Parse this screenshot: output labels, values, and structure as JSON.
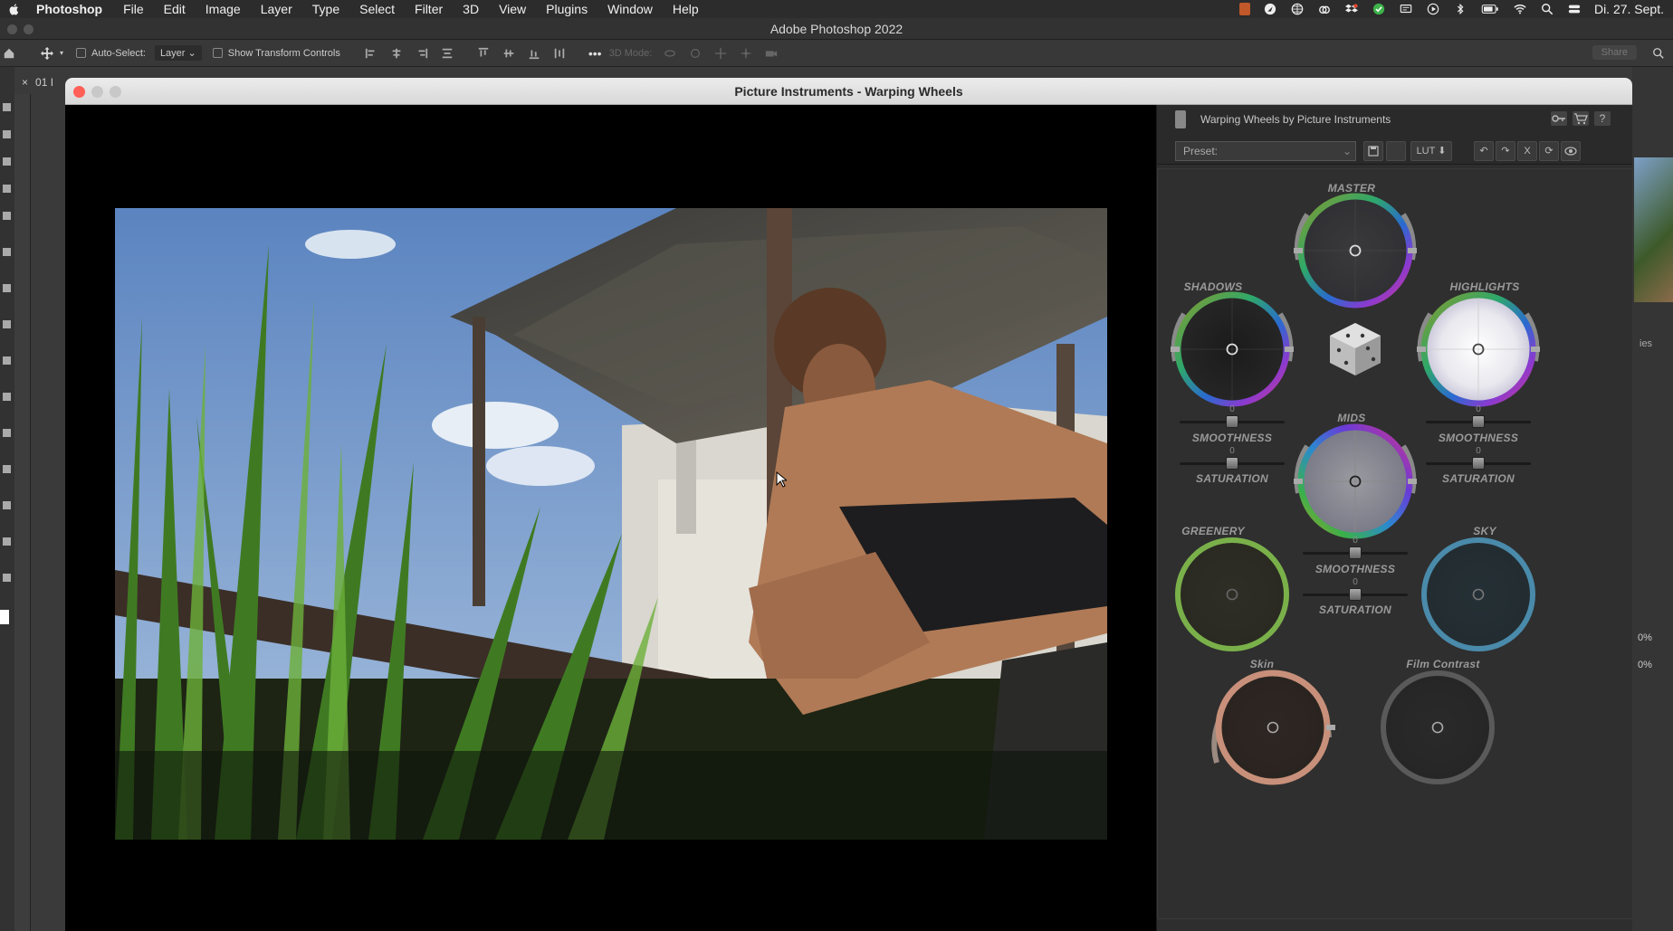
{
  "menubar": {
    "app_name": "Photoshop",
    "items": [
      "File",
      "Edit",
      "Image",
      "Layer",
      "Type",
      "Select",
      "Filter",
      "3D",
      "View",
      "Plugins",
      "Window",
      "Help"
    ],
    "clock": "Di. 27. Sept."
  },
  "ps": {
    "window_title": "Adobe Photoshop 2022",
    "options": {
      "auto_select_label": "Auto-Select:",
      "auto_select_value": "Layer",
      "show_transform_label": "Show Transform Controls",
      "mode_3d_label": "3D Mode:",
      "share_label": "Share"
    },
    "doc_tab": "01 I",
    "right_panel_text": "ies",
    "right_values": [
      "0%",
      "0%"
    ]
  },
  "plugin": {
    "title": "Picture Instruments - Warping Wheels",
    "header_title": "Warping Wheels by Picture Instruments",
    "preset_placeholder": "Preset:",
    "lut_label": "LUT",
    "reset_x": "X",
    "wheels": {
      "master": "MASTER",
      "shadows": "SHADOWS",
      "highlights": "HIGHLIGHTS",
      "mids": "MIDS",
      "greenery": "GREENERY",
      "sky": "SKY",
      "skin": "Skin",
      "film_contrast": "Film Contrast"
    },
    "sliders": {
      "smoothness": "SMOOTHNESS",
      "saturation": "SATURATION",
      "value": "0"
    }
  },
  "colors": {
    "close": "#ff5f57",
    "minimize": "#febc2e",
    "maximize": "#28c840",
    "panel_bg": "#2e2e2e"
  }
}
